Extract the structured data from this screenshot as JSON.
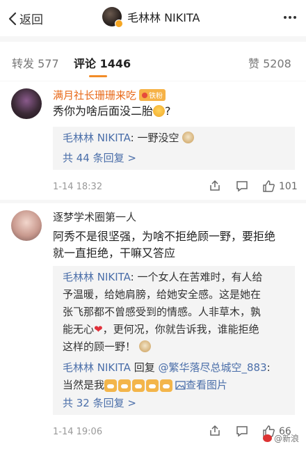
{
  "header": {
    "back_label": "返回",
    "account_name": "毛林林 NIKITA",
    "icons": {
      "back": "chevron-left-icon",
      "more": "more-icon"
    }
  },
  "tabs": {
    "repost": "转发 577",
    "comments": "评论 1446",
    "likes": "赞 5208"
  },
  "comments": [
    {
      "user": "满月社长珊珊来吃",
      "badge": "铁粉",
      "text": "秀你为啥后面没二胎",
      "replies": [
        {
          "author": "毛林林 NIKITA",
          "sep": ": ",
          "text": "一野没空"
        }
      ],
      "more_replies": "共 44 条回复 >",
      "time": "1-14 18:32",
      "like_count": "101"
    },
    {
      "user": "逐梦学术圈第一人",
      "text_lines": [
        "阿秀不是很坚强，为啥不拒绝顾一野，要拒绝",
        "就一直拒绝，干嘛又答应"
      ],
      "replies": [
        {
          "author": "毛林林 NIKITA",
          "sep": ": ",
          "lines": [
            "一个女人在苦难时，有人给",
            "予温暖，给她肩膀，给她安全感。这是她在",
            "张飞那都不曾感受到的情感。人非草木，孰",
            "能无心",
            "，更何况，你就告诉我，谁能拒绝",
            "这样的顾一野！"
          ]
        },
        {
          "author": "毛林林 NIKITA",
          "middle": " 回复 ",
          "target": "@繁华落尽总城空_883",
          "sep": ":",
          "text": "当然是我",
          "view_image": "查看图片"
        }
      ],
      "more_replies": "共 32 条回复 >",
      "time": "1-14 19:06",
      "like_count": "66"
    }
  ],
  "watermark": "@新浪",
  "colors": {
    "link": "#4a6ea9",
    "tab_indicator": "#f28c28",
    "name_orange": "#e86a1a"
  }
}
